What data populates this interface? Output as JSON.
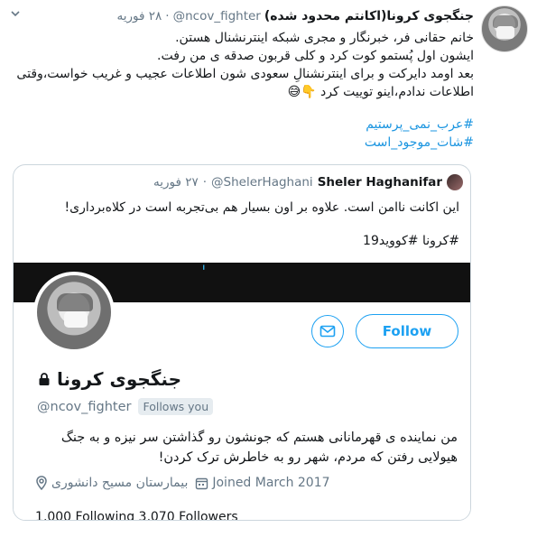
{
  "tweet": {
    "display_name": "جنگجوی کرونا(اکانتم محدود شده)",
    "handle": "@ncov_fighter",
    "separator": "·",
    "date": "۲۸ فوریه",
    "body_lines": [
      "خانم حقانی فر، خبرنگار و مجری شبکه اینترنشنال هستن.",
      "ایشون اول پُستمو کوت کرد و کلی قربون صدقه ی من رفت.",
      "بعد اومد دایرکت و برای اینترنشنالِ سعودی شون اطلاعات عجیب و غریب خواست،وقتی اطلاعات ندادم،اینو توییت کرد 👇😅"
    ],
    "hashtags": [
      "#عرب_نمی_پرستیم",
      "#شات_موجود_است"
    ]
  },
  "quoted": {
    "name": "Sheler Haghanifar",
    "handle": "@ShelerHaghani",
    "separator": "·",
    "date": "۲۷ فوریه",
    "text": "این اکانت ناامن است. علاوه بر اون بسیار هم بی‌تجربه است در کلاه‌برداری!",
    "hashtags": "#کرونا #کووید19"
  },
  "profile_card": {
    "name": "جنگجوی کرونا",
    "handle": "@ncov_fighter",
    "follows_you": "Follows you",
    "follow_label": "Follow",
    "bio": "من نماینده ی قهرمانانی هستم که جونشون رو گذاشتن سر نیزه و به جنگ هیولایی رفتن که مردم، شهر رو به خاطرش ترک کردن!",
    "location": "بیمارستان مسیح دانشوری",
    "joined": "Joined March 2017",
    "stats_partial": "1,000 Following   3,070 Followers"
  },
  "colors": {
    "accent": "#1da1f2",
    "link": "#1b95e0",
    "muted": "#657786",
    "text": "#14171a"
  },
  "icons": [
    "chevron-down-icon",
    "lock-icon",
    "envelope-icon",
    "location-icon",
    "calendar-icon"
  ]
}
